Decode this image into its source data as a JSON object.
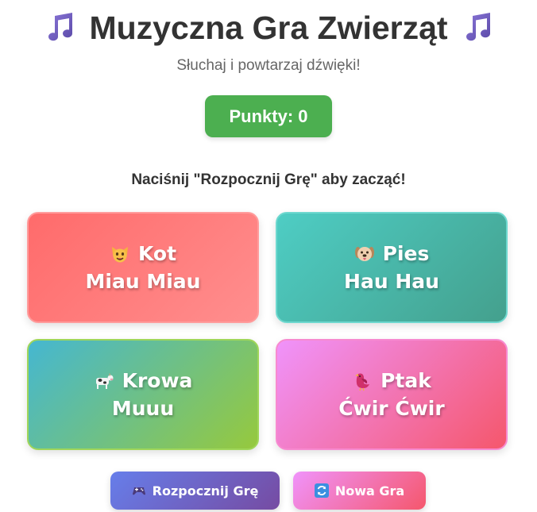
{
  "header": {
    "title": "Muzyczna Gra Zwierząt",
    "subtitle": "Słuchaj i powtarzaj dźwięki!",
    "icon": "music-note-icon"
  },
  "score": {
    "label": "Punkty: 0",
    "color": "#4caf50"
  },
  "instruction": "Naciśnij \"Rozpocznij Grę\" aby zacząć!",
  "animals": [
    {
      "name": "Kot",
      "sound": "Miau Miau",
      "icon": "cat-face-icon",
      "colors": [
        "#ff6b6b",
        "#ff8e8e"
      ]
    },
    {
      "name": "Pies",
      "sound": "Hau Hau",
      "icon": "dog-face-icon",
      "colors": [
        "#4ecdc4",
        "#44a08d"
      ]
    },
    {
      "name": "Krowa",
      "sound": "Muuu",
      "icon": "cow-icon",
      "colors": [
        "#45b7d1",
        "#96c93d"
      ]
    },
    {
      "name": "Ptak",
      "sound": "Ćwir Ćwir",
      "icon": "bird-icon",
      "colors": [
        "#f093fb",
        "#f5576c"
      ]
    }
  ],
  "controls": {
    "start_label": "Rozpocznij Grę",
    "start_icon": "gamepad-icon",
    "new_game_label": "Nowa Gra",
    "new_game_icon": "refresh-icon"
  }
}
